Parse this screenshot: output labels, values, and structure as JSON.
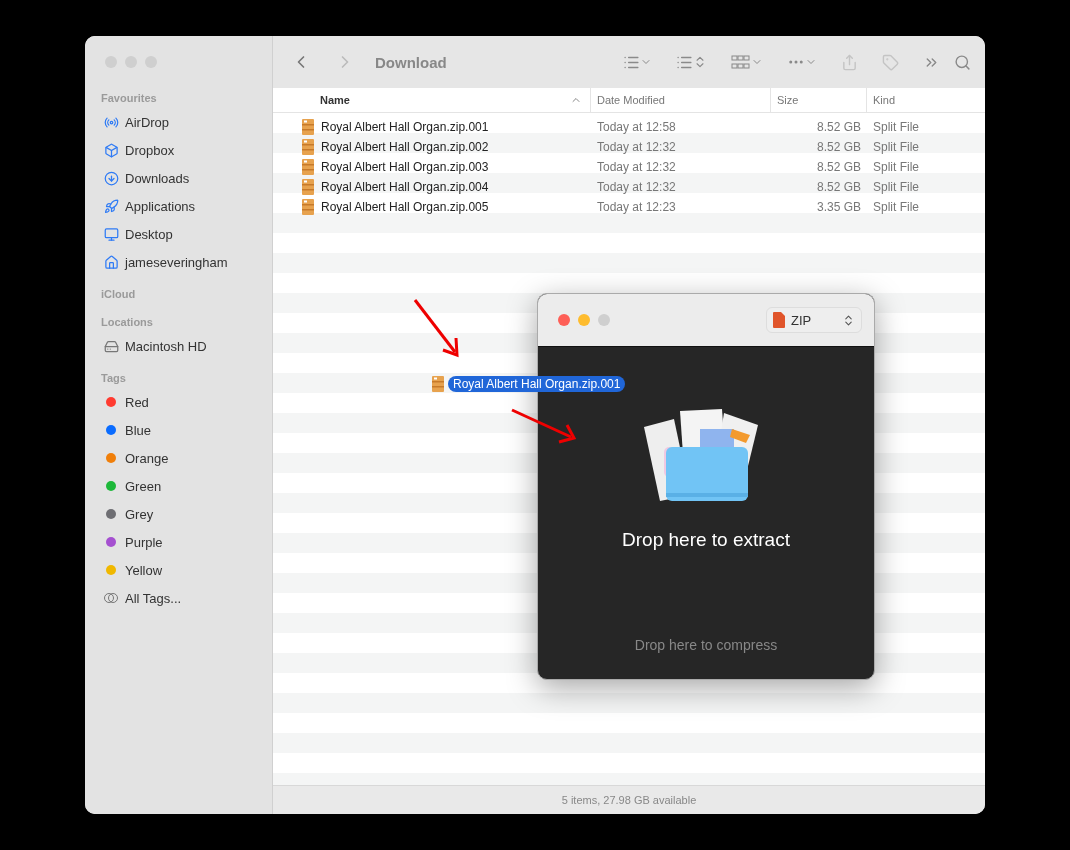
{
  "window": {
    "title": "Download"
  },
  "sidebar": {
    "sections": [
      {
        "heading": "Favourites",
        "items": [
          {
            "label": "AirDrop",
            "kind": "place"
          },
          {
            "label": "Dropbox",
            "kind": "place"
          },
          {
            "label": "Downloads",
            "kind": "place"
          },
          {
            "label": "Applications",
            "kind": "place"
          },
          {
            "label": "Desktop",
            "kind": "place"
          },
          {
            "label": "jameseveringham",
            "kind": "place"
          }
        ]
      },
      {
        "heading": "iCloud"
      },
      {
        "heading": "Locations",
        "items": [
          {
            "label": "Macintosh HD",
            "kind": "disk"
          }
        ]
      },
      {
        "heading": "Tags",
        "items": [
          {
            "label": "Red",
            "kind": "tag",
            "color": "#ff3b30"
          },
          {
            "label": "Blue",
            "kind": "tag",
            "color": "#0a6cff"
          },
          {
            "label": "Orange",
            "kind": "tag",
            "color": "#f07f0a"
          },
          {
            "label": "Green",
            "kind": "tag",
            "color": "#1db83a"
          },
          {
            "label": "Grey",
            "kind": "tag",
            "color": "#6e6e73"
          },
          {
            "label": "Purple",
            "kind": "tag",
            "color": "#a550d0"
          },
          {
            "label": "Yellow",
            "kind": "tag",
            "color": "#f0b800"
          },
          {
            "label": "All Tags...",
            "kind": "all-tags"
          }
        ]
      }
    ]
  },
  "table": {
    "columns": [
      {
        "label": "Name",
        "sorted": true
      },
      {
        "label": "Date Modified",
        "sorted": false
      },
      {
        "label": "Size",
        "sorted": false
      },
      {
        "label": "Kind",
        "sorted": false
      }
    ],
    "rows": [
      [
        "Royal Albert Hall Organ.zip.001",
        "Today at 12:58",
        "8.52 GB",
        "Split File"
      ],
      [
        "Royal Albert Hall Organ.zip.002",
        "Today at 12:32",
        "8.52 GB",
        "Split File"
      ],
      [
        "Royal Albert Hall Organ.zip.003",
        "Today at 12:32",
        "8.52 GB",
        "Split File"
      ],
      [
        "Royal Albert Hall Organ.zip.004",
        "Today at 12:32",
        "8.52 GB",
        "Split File"
      ],
      [
        "Royal Albert Hall Organ.zip.005",
        "Today at 12:23",
        "3.35 GB",
        "Split File"
      ]
    ]
  },
  "status_bar": "5 items, 27.98 GB available",
  "drag_item": {
    "label": "Royal Albert Hall Organ.zip.001"
  },
  "archiver": {
    "format": "ZIP",
    "extract_label": "Drop here to extract",
    "compress_label": "Drop here to compress"
  }
}
